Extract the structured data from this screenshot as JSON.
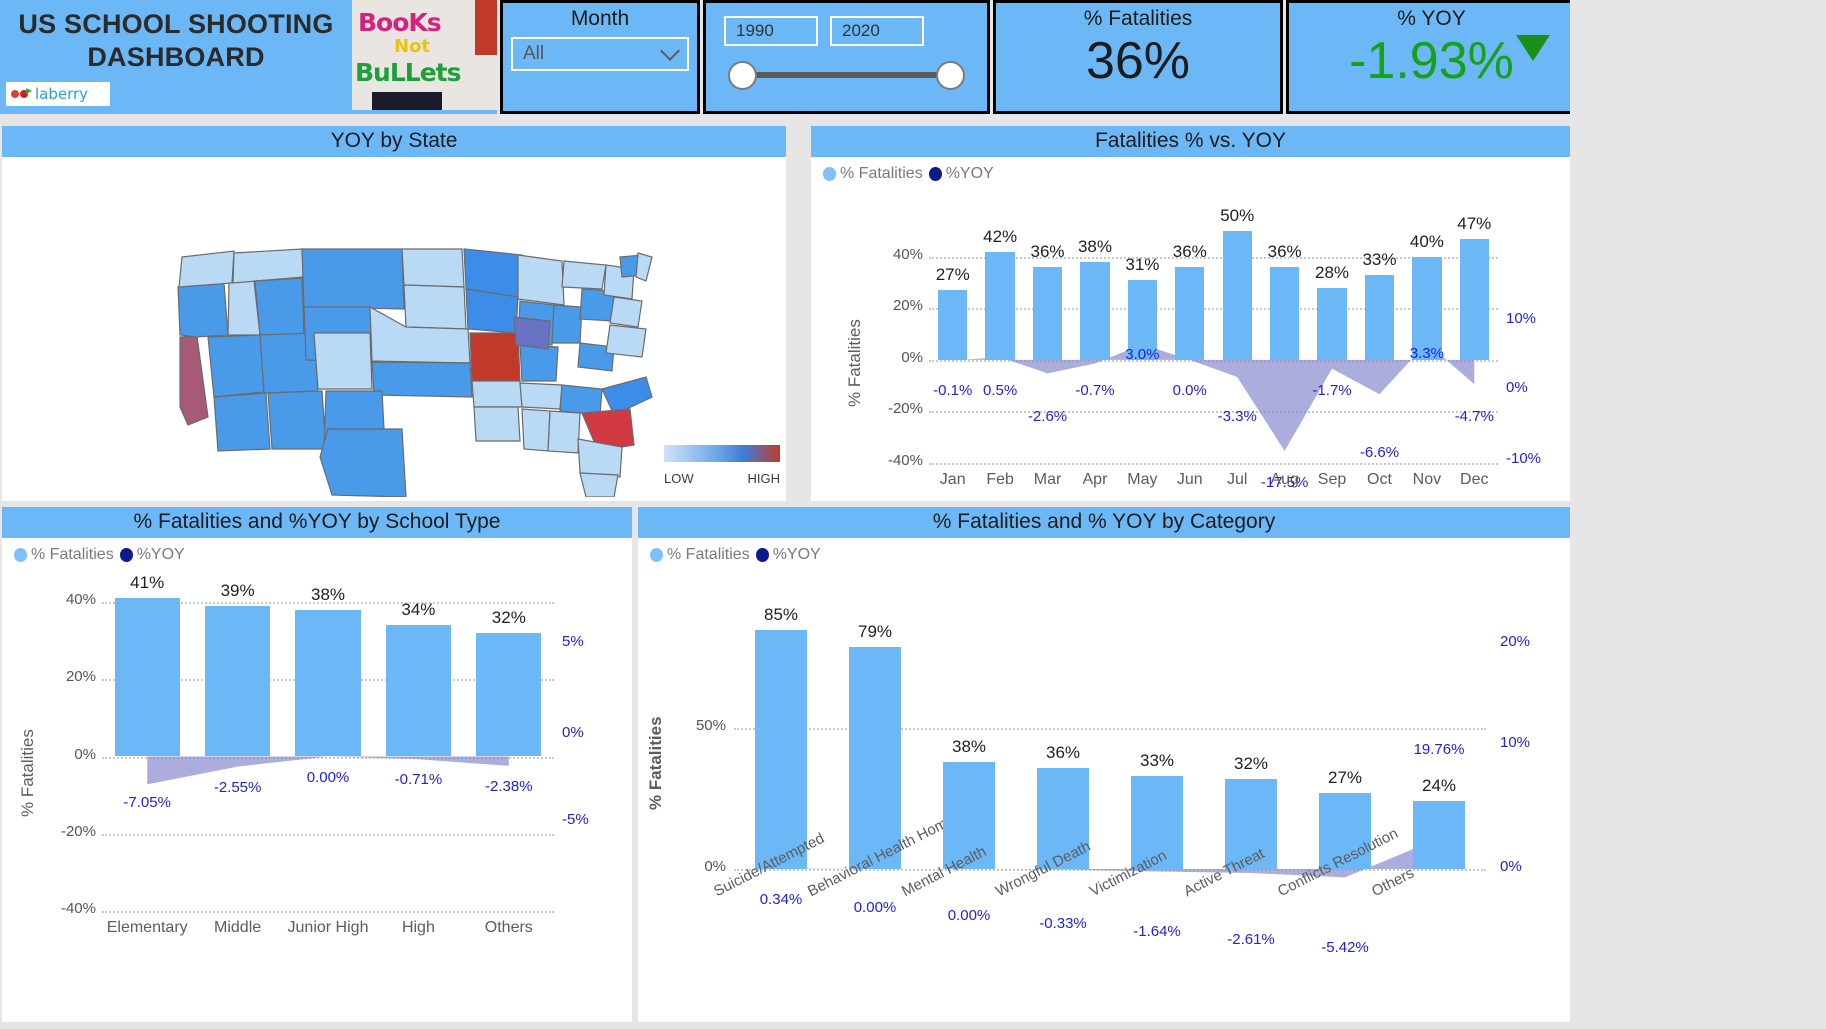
{
  "header": {
    "title": "US SCHOOL SHOOTING DASHBOARD",
    "logo_text": "laberry",
    "photo_text_1": "BooKs",
    "photo_text_2": "Not",
    "photo_text_3": "BuLLets",
    "month_label": "Month",
    "month_value": "All",
    "year_min": "1990",
    "year_max": "2020",
    "kpi_fatalities_label": "% Fatalities",
    "kpi_fatalities_value": "36%",
    "kpi_yoy_label": "% YOY",
    "kpi_yoy_value": "-1.93%",
    "kpi_yoy_color": "#17a117",
    "kpi_yoy_trend_icon": "triangle-down-icon"
  },
  "map": {
    "title": "YOY by State",
    "legend_low": "LOW",
    "legend_high": "HIGH",
    "legend_low_color": "#cfe4f8",
    "legend_high_color": "#c0392b"
  },
  "legend": {
    "fatalities": "% Fatalities",
    "yoy": "%YOY"
  },
  "chart_data": [
    {
      "id": "monthly",
      "type": "bar",
      "title": "Fatalities % vs. YOY",
      "xlabel": "",
      "ylabel": "% Fatalities",
      "ylim": [
        -40,
        50
      ],
      "y_ticks": [
        "40%",
        "20%",
        "0%",
        "-20%",
        "-40%"
      ],
      "y2_ticks": [
        "10%",
        "0%",
        "-10%"
      ],
      "y2lim": [
        -13,
        13
      ],
      "grid": true,
      "legend_position": "top-left",
      "categories": [
        "Jan",
        "Feb",
        "Mar",
        "Apr",
        "May",
        "Jun",
        "Jul",
        "Aug",
        "Sep",
        "Oct",
        "Nov",
        "Dec"
      ],
      "series": [
        {
          "name": "% Fatalities",
          "type": "bar",
          "color": "#6cb8f7",
          "values": [
            27,
            42,
            36,
            38,
            31,
            36,
            50,
            36,
            28,
            33,
            40,
            47
          ],
          "labels": [
            "27%",
            "42%",
            "36%",
            "38%",
            "31%",
            "36%",
            "50%",
            "36%",
            "28%",
            "33%",
            "40%",
            "47%"
          ]
        },
        {
          "name": "%YOY",
          "type": "area",
          "color": "#8a8fd0",
          "values": [
            -0.1,
            0.5,
            -2.6,
            -0.7,
            3.0,
            0.0,
            -3.3,
            -17.5,
            -1.7,
            -6.6,
            3.3,
            -4.7
          ],
          "labels": [
            "-0.1%",
            "0.5%",
            "-2.6%",
            "-0.7%",
            "3.0%",
            "0.0%",
            "-3.3%",
            "-17.5%",
            "-1.7%",
            "-6.6%",
            "3.3%",
            "-4.7%"
          ]
        }
      ]
    },
    {
      "id": "school_type",
      "type": "bar",
      "title": "% Fatalities and %YOY by School Type",
      "xlabel": "",
      "ylabel": "% Fatalities",
      "ylim": [
        -40,
        40
      ],
      "y_ticks": [
        "40%",
        "20%",
        "0%",
        "-20%",
        "-40%"
      ],
      "y2_ticks": [
        "5%",
        "0%",
        "-5%"
      ],
      "grid": true,
      "legend_position": "top-left",
      "categories": [
        "Elementary",
        "Middle",
        "Junior High",
        "High",
        "Others"
      ],
      "series": [
        {
          "name": "% Fatalities",
          "type": "bar",
          "color": "#6cb8f7",
          "values": [
            41,
            39,
            38,
            34,
            32
          ],
          "labels": [
            "41%",
            "39%",
            "38%",
            "34%",
            "32%"
          ]
        },
        {
          "name": "%YOY",
          "type": "area",
          "color": "#8a8fd0",
          "values": [
            -7.05,
            -2.55,
            0.0,
            -0.71,
            -2.38
          ],
          "labels": [
            "-7.05%",
            "-2.55%",
            "0.00%",
            "-0.71%",
            "-2.38%"
          ]
        }
      ]
    },
    {
      "id": "category",
      "type": "bar",
      "title": "% Fatalities and % YOY by Category",
      "xlabel": "",
      "ylabel": "% Fatalities",
      "ylim": [
        0,
        90
      ],
      "y_ticks": [
        "50%",
        "0%"
      ],
      "y2_ticks": [
        "20%",
        "10%",
        "0%"
      ],
      "grid": true,
      "legend_position": "top-left",
      "categories": [
        "Suicide/Attempted",
        "Behavioral Health Homici...",
        "Mental Health",
        "Wrongful Death",
        "Victimization",
        "Active Threat",
        "Conflicts Resolution",
        "Others"
      ],
      "series": [
        {
          "name": "% Fatalities",
          "type": "bar",
          "color": "#6cb8f7",
          "values": [
            85,
            79,
            38,
            36,
            33,
            32,
            27,
            24
          ],
          "labels": [
            "85%",
            "79%",
            "38%",
            "36%",
            "33%",
            "32%",
            "27%",
            "24%"
          ]
        },
        {
          "name": "%YOY",
          "type": "area",
          "color": "#8a8fd0",
          "values": [
            0.34,
            0.0,
            0.0,
            -0.33,
            -1.64,
            -2.61,
            -5.42,
            19.76
          ],
          "labels": [
            "0.34%",
            "0.00%",
            "0.00%",
            "-0.33%",
            "-1.64%",
            "-2.61%",
            "-5.42%",
            "19.76%"
          ]
        }
      ]
    }
  ]
}
